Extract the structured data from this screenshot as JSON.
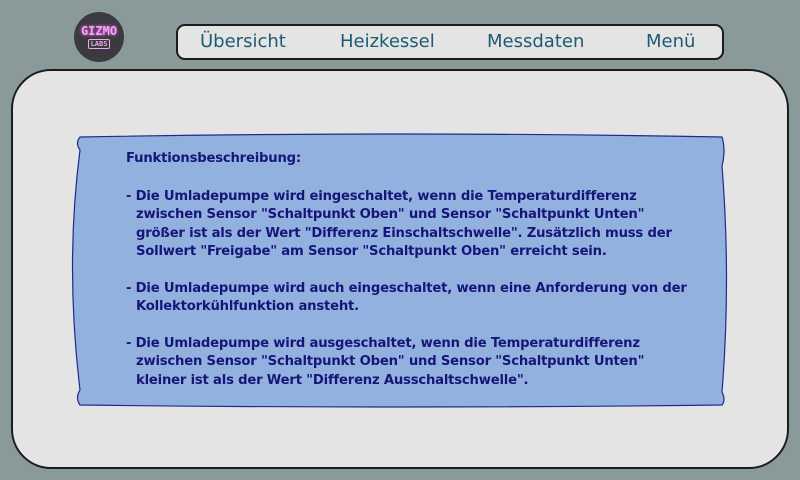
{
  "logo": {
    "line1": "GIZMO",
    "line2": "LABS"
  },
  "nav": {
    "items": [
      {
        "label": "Übersicht"
      },
      {
        "label": "Heizkessel"
      },
      {
        "label": "Messdaten"
      },
      {
        "label": "Menü"
      }
    ]
  },
  "description": {
    "heading": "Funktionsbeschreibung:",
    "paragraphs": [
      "- Die Umladepumpe wird eingeschaltet, wenn die Temperaturdifferenz zwischen Sensor \"Schaltpunkt Oben\" und Sensor \"Schaltpunkt Unten\" größer ist als der Wert \"Differenz Einschaltschwelle\". Zusätzlich muss der Sollwert \"Freigabe\" am Sensor \"Schaltpunkt Oben\" erreicht sein.",
      "- Die Umladepumpe wird auch eingeschaltet, wenn eine Anforderung von der Kollektorkühlfunktion ansteht.",
      "- Die Umladepumpe wird ausgeschaltet, wenn die Temperaturdifferenz zwischen Sensor \"Schaltpunkt Oben\" und Sensor \"Schaltpunkt Unten\" kleiner ist als der Wert \"Differenz Ausschaltschwelle\"."
    ]
  },
  "colors": {
    "background": "#8a9a9b",
    "panel": "#e4e4e4",
    "scroll": "#93b1df",
    "text": "#16167a",
    "nav_text": "#1e5b73"
  }
}
